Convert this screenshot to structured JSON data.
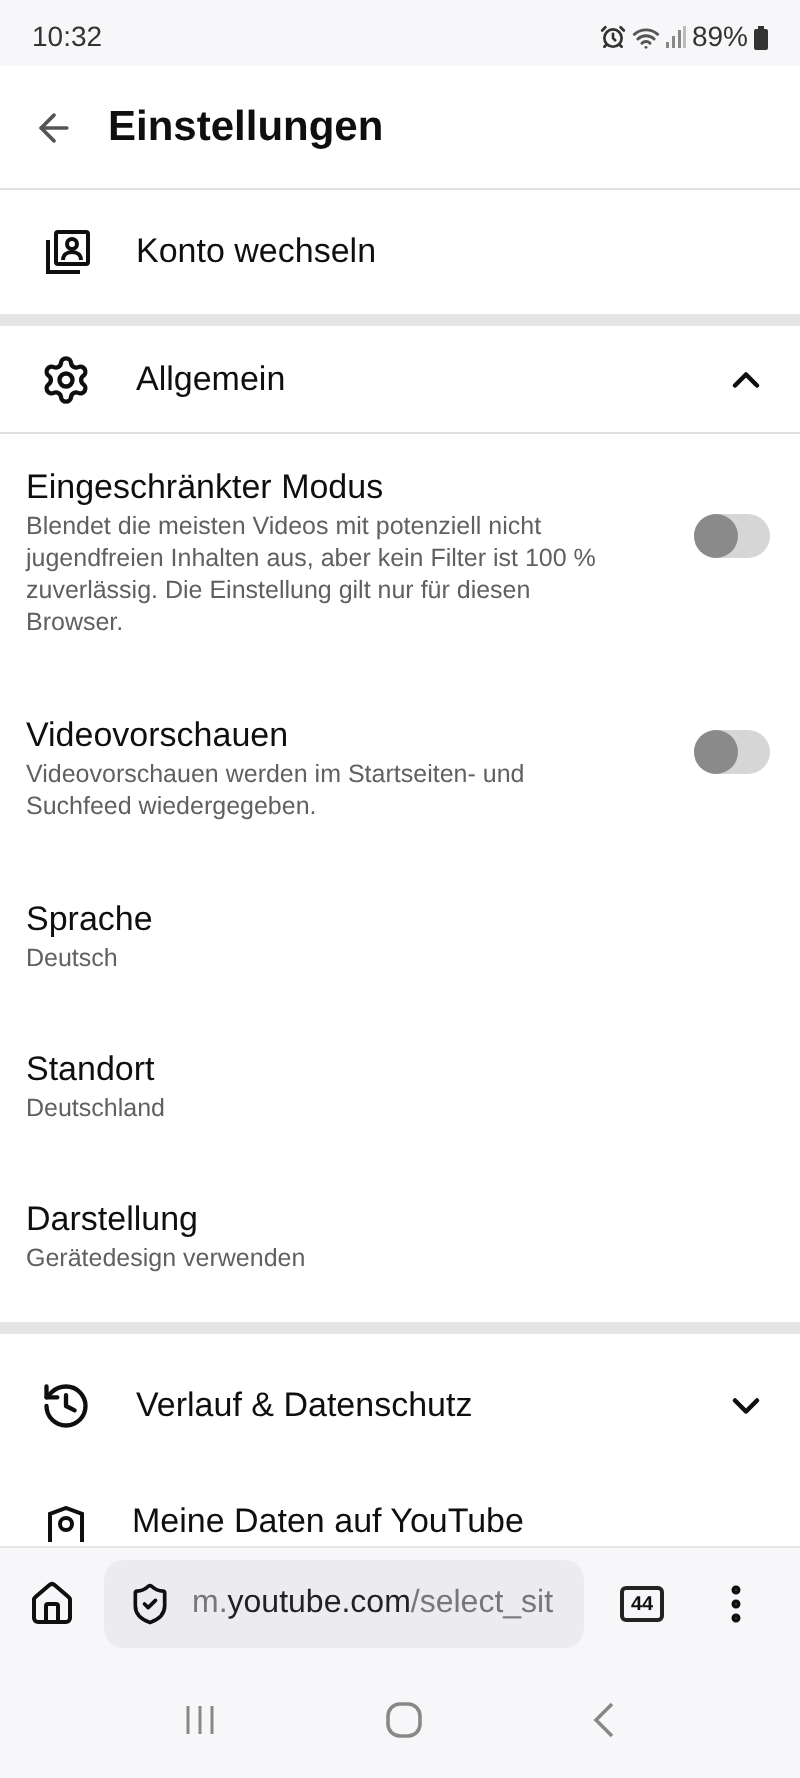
{
  "status_bar": {
    "time": "10:32",
    "battery": "89%"
  },
  "header": {
    "title": "Einstellungen"
  },
  "account": {
    "label": "Konto wechseln"
  },
  "sections": [
    {
      "kind": "general",
      "label": "Allgemein",
      "expanded": true,
      "items": [
        {
          "kind": "toggle",
          "title": "Eingeschränkter Modus",
          "description": "Blendet die meisten Videos mit potenziell nicht jugendfreien Inhalten aus, aber kein Filter ist 100 % zuverlässig. Die Einstellung gilt nur für diesen Browser.",
          "on": false
        },
        {
          "kind": "toggle",
          "title": "Videovorschauen",
          "description": "Videovorschauen werden im Startseiten- und Suchfeed wiedergegeben.",
          "on": false
        },
        {
          "kind": "value",
          "title": "Sprache",
          "description": "Deutsch"
        },
        {
          "kind": "value",
          "title": "Standort",
          "description": "Deutschland"
        },
        {
          "kind": "value",
          "title": "Darstellung",
          "description": "Gerätedesign verwenden"
        }
      ]
    },
    {
      "kind": "history",
      "label": "Verlauf & Datenschutz",
      "expanded": false
    }
  ],
  "next_item": {
    "label": "Meine Daten auf YouTube"
  },
  "browser_bar": {
    "url_prefix": "m.",
    "url_domain": "youtube.com",
    "url_path": "/select_sit",
    "tab_count": "44"
  }
}
